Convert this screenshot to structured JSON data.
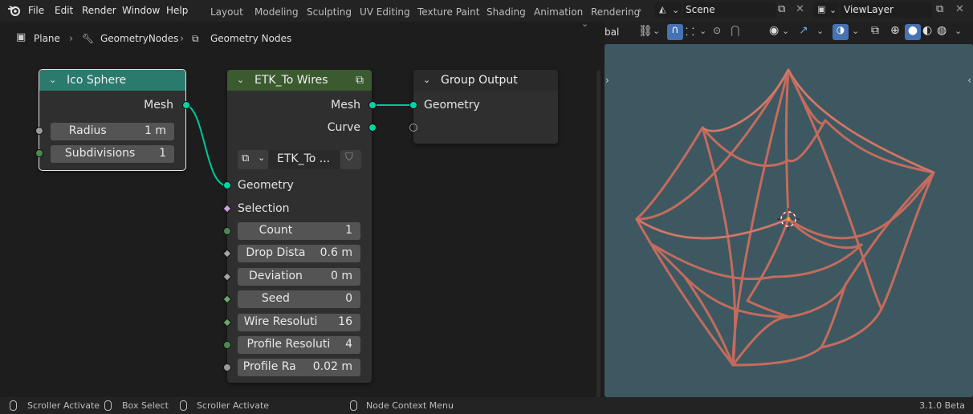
{
  "menu": [
    "File",
    "Edit",
    "Render",
    "Window",
    "Help"
  ],
  "workspaces": [
    "Layout",
    "Modeling",
    "Sculpting",
    "UV Editing",
    "Texture Paint",
    "Shading",
    "Animation",
    "Rendering"
  ],
  "scene": {
    "name": "Scene"
  },
  "view_layer": {
    "name": "ViewLayer"
  },
  "breadcrumb": {
    "object": "Plane",
    "modifier": "GeometryNodes",
    "tree": "Geometry Nodes"
  },
  "nodes": {
    "ico_sphere": {
      "title": "Ico Sphere",
      "header_color": "#2a7a6e",
      "output": "Mesh",
      "radius_label": "Radius",
      "radius_value": "1 m",
      "subdiv_label": "Subdivisions",
      "subdiv_value": "1"
    },
    "to_wires": {
      "title": "ETK_To Wires",
      "header_color": "#3b5a2f",
      "out_mesh": "Mesh",
      "out_curve": "Curve",
      "group_name": "ETK_To ...",
      "in_geometry": "Geometry",
      "in_selection": "Selection",
      "inputs": [
        {
          "label": "Count",
          "value": "1"
        },
        {
          "label": "Drop Dista",
          "value": "0.6 m"
        },
        {
          "label": "Deviation",
          "value": "0 m"
        },
        {
          "label": "Seed",
          "value": "0"
        },
        {
          "label": "Wire Resoluti",
          "value": "16"
        },
        {
          "label": "Profile Resoluti",
          "value": "4"
        },
        {
          "label": "Profile Ra",
          "value": "0.02 m"
        }
      ]
    },
    "group_output": {
      "title": "Group Output",
      "header_color": "#2a2a2a",
      "input": "Geometry"
    }
  },
  "viewport": {
    "orientation_label": "bal",
    "background_color": "#3d5860",
    "wire_color": "#c46b5e"
  },
  "status": {
    "scroller_activate_1": "Scroller Activate",
    "box_select": "Box Select",
    "scroller_activate_2": "Scroller Activate",
    "node_context_menu": "Node Context Menu",
    "version": "3.1.0 Beta"
  }
}
